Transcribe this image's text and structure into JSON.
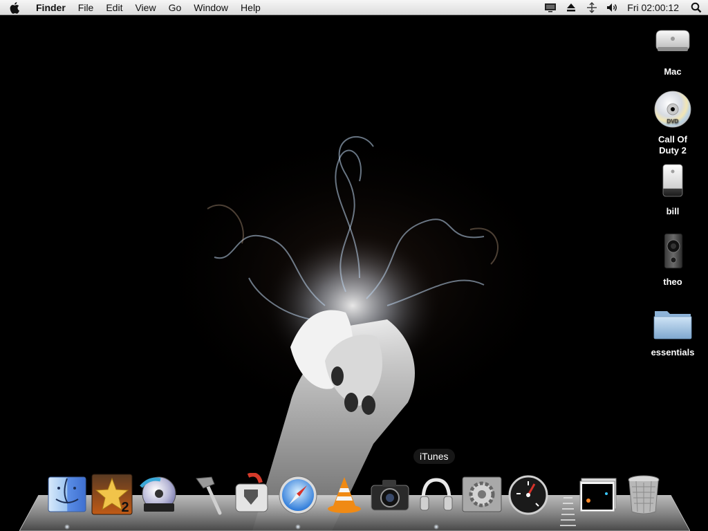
{
  "menubar": {
    "app_name": "Finder",
    "menus": [
      "File",
      "Edit",
      "View",
      "Go",
      "Window",
      "Help"
    ],
    "clock": "Fri 02:00:12"
  },
  "desktop_icons": [
    {
      "label": "Mac",
      "icon": "mac-mini-icon"
    },
    {
      "label": "Call Of Duty 2",
      "icon": "dvd-icon"
    },
    {
      "label": "bill",
      "icon": "external-drive-icon"
    },
    {
      "label": "theo",
      "icon": "speaker-drive-icon"
    },
    {
      "label": "essentials",
      "icon": "folder-icon"
    }
  ],
  "dock": {
    "tooltip": "iTunes",
    "items": [
      "finder",
      "imovie-star",
      "dvd-player",
      "xcode-hammer",
      "automator",
      "safari",
      "vlc",
      "photo-booth",
      "itunes",
      "system-preferences",
      "dashboard",
      "stack",
      "trash"
    ]
  }
}
